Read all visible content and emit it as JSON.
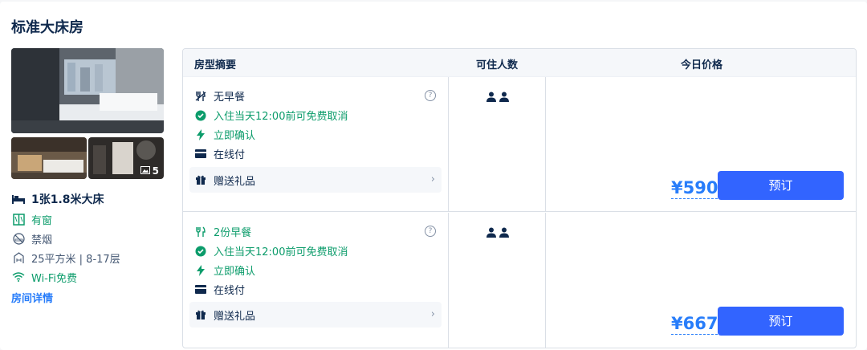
{
  "room": {
    "title": "标准大床房",
    "photo_count": "5",
    "bed": "1张1.8米大床",
    "window": "有窗",
    "smoking": "禁烟",
    "area_floor": "25平方米 | 8-17层",
    "wifi": "Wi-Fi免费",
    "details_link": "房间详情"
  },
  "table": {
    "headers": [
      "房型摘要",
      "可住人数",
      "今日价格"
    ],
    "rows": [
      {
        "meal": "无早餐",
        "cancel": "入住当天12:00前可免费取消",
        "confirm": "立即确认",
        "payment": "在线付",
        "gift": "赠送礼品",
        "guests": 2,
        "price": "¥590",
        "book_label": "预订"
      },
      {
        "meal": "2份早餐",
        "cancel": "入住当天12:00前可免费取消",
        "confirm": "立即确认",
        "payment": "在线付",
        "gift": "赠送礼品",
        "guests": 2,
        "price": "¥667",
        "book_label": "预订"
      }
    ]
  },
  "icons": {
    "bed": "bed-icon",
    "window": "window-icon",
    "no_smoking": "no-smoking-icon",
    "area": "area-icon",
    "wifi": "wifi-icon",
    "no_meal": "no-meal-icon",
    "meal": "meal-icon",
    "check": "check-circle-icon",
    "bolt": "bolt-icon",
    "card": "card-icon",
    "gift": "gift-icon",
    "person": "person-icon",
    "photo": "photo-icon",
    "help": "question-icon",
    "chevron": "chevron-right-icon"
  },
  "colors": {
    "accent": "#287dfa",
    "button": "#3264ff",
    "green": "#0c9c6b",
    "text": "#0f294d"
  }
}
